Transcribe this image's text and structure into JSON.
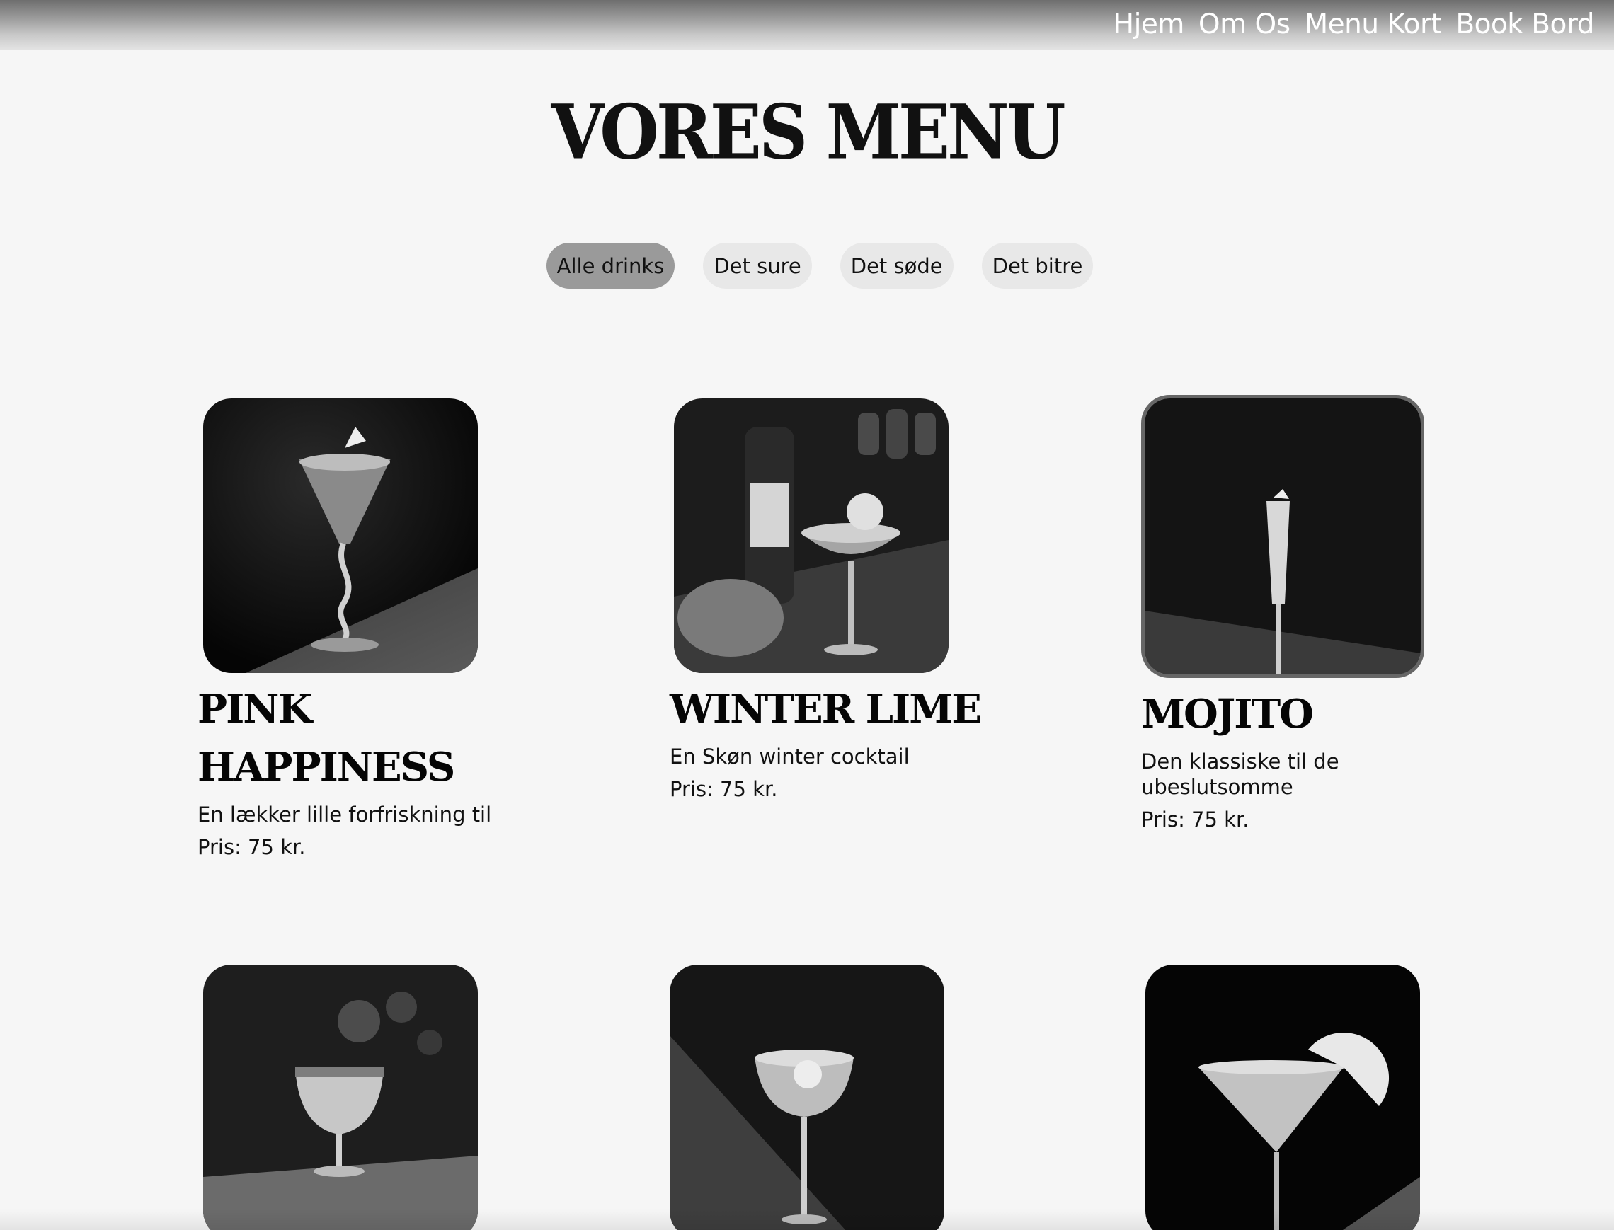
{
  "nav": {
    "items": [
      {
        "label": "Hjem"
      },
      {
        "label": "Om Os"
      },
      {
        "label": "Menu Kort"
      },
      {
        "label": "Book Bord"
      }
    ]
  },
  "page": {
    "title": "VORES MENU"
  },
  "filters": [
    {
      "label": "Alle drinks",
      "active": true
    },
    {
      "label": "Det sure",
      "active": false
    },
    {
      "label": "Det søde",
      "active": false
    },
    {
      "label": "Det bitre",
      "active": false
    }
  ],
  "drinks": [
    {
      "name": "PINK HAPPINESS",
      "description": "En lækker lille forfriskning til",
      "price": "Pris: 75 kr."
    },
    {
      "name": "WINTER LIME",
      "description": "En Skøn winter cocktail",
      "price": "Pris: 75 kr."
    },
    {
      "name": "MOJITO",
      "description": "Den klassiske til de ubeslutsomme",
      "price": "Pris: 75 kr."
    },
    {
      "name": "",
      "description": "",
      "price": ""
    },
    {
      "name": "",
      "description": "",
      "price": ""
    },
    {
      "name": "",
      "description": "",
      "price": ""
    }
  ]
}
